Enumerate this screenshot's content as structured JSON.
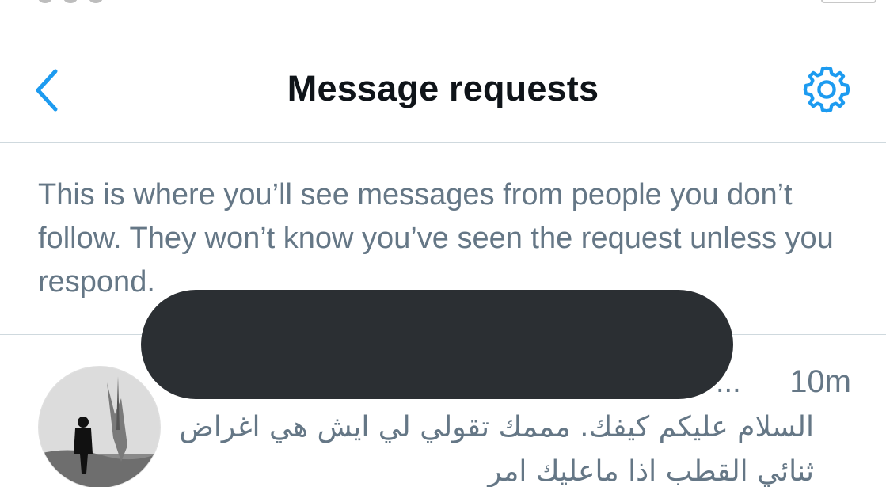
{
  "header": {
    "title": "Message requests",
    "back_icon": "chevron-left-icon",
    "settings_icon": "gear-icon",
    "accent_color": "#1d9bf0"
  },
  "info": {
    "text": "This is where you’ll see messages from people you don’t follow. They won’t know you’ve seen the request unless you respond."
  },
  "request": {
    "name_truncated": "...",
    "timestamp": "10m",
    "message": "السلام عليكم كيفك. مممك تقولي لي ايش هي اغراض ثنائي القطب اذا ماعليك امر"
  },
  "colors": {
    "title": "#0f1419",
    "secondary_text": "#657786",
    "divider": "#cfd9de",
    "redaction": "#2b2f33"
  }
}
